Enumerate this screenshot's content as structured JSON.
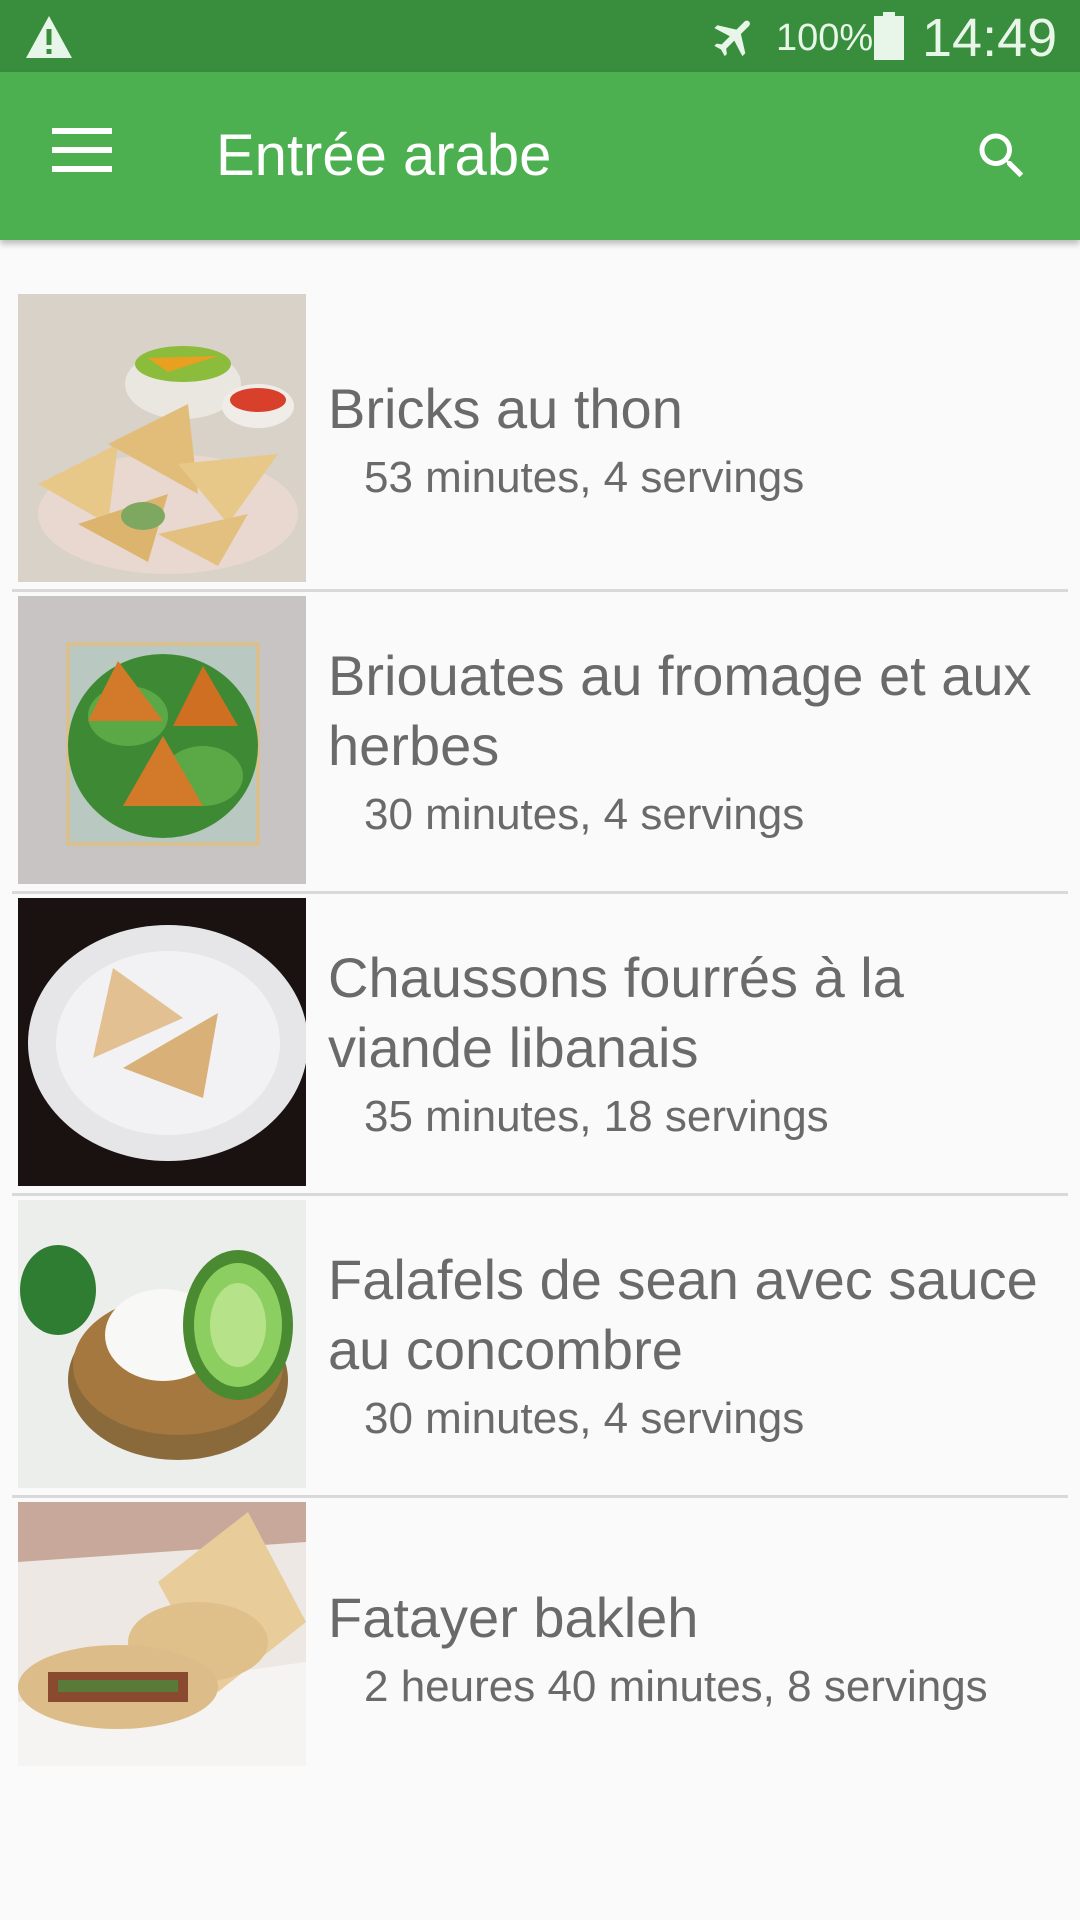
{
  "status_bar": {
    "battery_percent": "100%",
    "time": "14:49",
    "icons": [
      "warning-icon",
      "airplane-mode-icon",
      "battery-icon"
    ]
  },
  "app_bar": {
    "title": "Entrée arabe",
    "icons": [
      "menu-icon",
      "search-icon"
    ],
    "color": "#4caf50",
    "status_color": "#388e3c"
  },
  "recipes": [
    {
      "title": "Bricks au thon",
      "meta": "53 minutes, 4 servings"
    },
    {
      "title": "Briouates au fromage et aux herbes",
      "meta": "30 minutes, 4 servings"
    },
    {
      "title": "Chaussons fourrés à la viande libanais",
      "meta": "35 minutes, 18 servings"
    },
    {
      "title": "Falafels de sean avec sauce au concombre",
      "meta": "30 minutes, 4 servings"
    },
    {
      "title": "Fatayer bakleh",
      "meta": "2 heures 40 minutes, 8 servings"
    }
  ]
}
